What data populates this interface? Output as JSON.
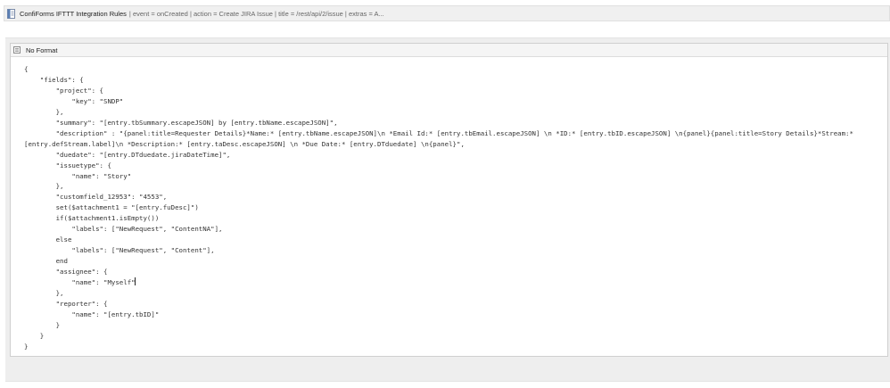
{
  "macro_header": {
    "title": "ConfiForms IFTTT Integration Rules",
    "params": " | event = onCreated | action = Create JIRA Issue | title = /rest/api/2/issue | extras = A..."
  },
  "code_block": {
    "title": "No Format",
    "lines": [
      "{",
      "    \"fields\": {",
      "        \"project\": {",
      "            \"key\": \"SNDP\"",
      "        },",
      "        \"summary\": \"[entry.tbSummary.escapeJSON] by [entry.tbName.escapeJSON]\",",
      "        \"description\" : \"{panel:title=Requester Details}*Name:* [entry.tbName.escapeJSON]\\n *Email Id:* [entry.tbEmail.escapeJSON] \\n *ID:* [entry.tbID.escapeJSON] \\n{panel}{panel:title=Story Details}*Stream:*",
      "[entry.defStream.label]\\n *Description:* [entry.taDesc.escapeJSON] \\n *Due Date:* [entry.DTduedate] \\n{panel}\",",
      "        \"duedate\": \"[entry.DTduedate.jiraDateTime]\",",
      "        \"issuetype\": {",
      "            \"name\": \"Story\"",
      "        },",
      "        \"customfield_12953\": \"4553\",",
      "        set($attachment1 = \"[entry.fuDesc]\")",
      "        if($attachment1.isEmpty())",
      "            \"labels\": [\"NewRequest\", \"ContentNA\"],",
      "        else",
      "            \"labels\": [\"NewRequest\", \"Content\"],",
      "        end",
      "        \"assignee\": {",
      "            \"name\": \"Myself\"",
      "        },",
      "        \"reporter\": {",
      "            \"name\": \"[entry.tbID]\"",
      "        }",
      "    }",
      "}"
    ]
  },
  "colors": {
    "panel_bg": "#eeeeee",
    "header_bg": "#f5f5f5",
    "border": "#cfcfcf"
  },
  "icons": {
    "macro": "document-icon",
    "code": "code-block-icon"
  }
}
